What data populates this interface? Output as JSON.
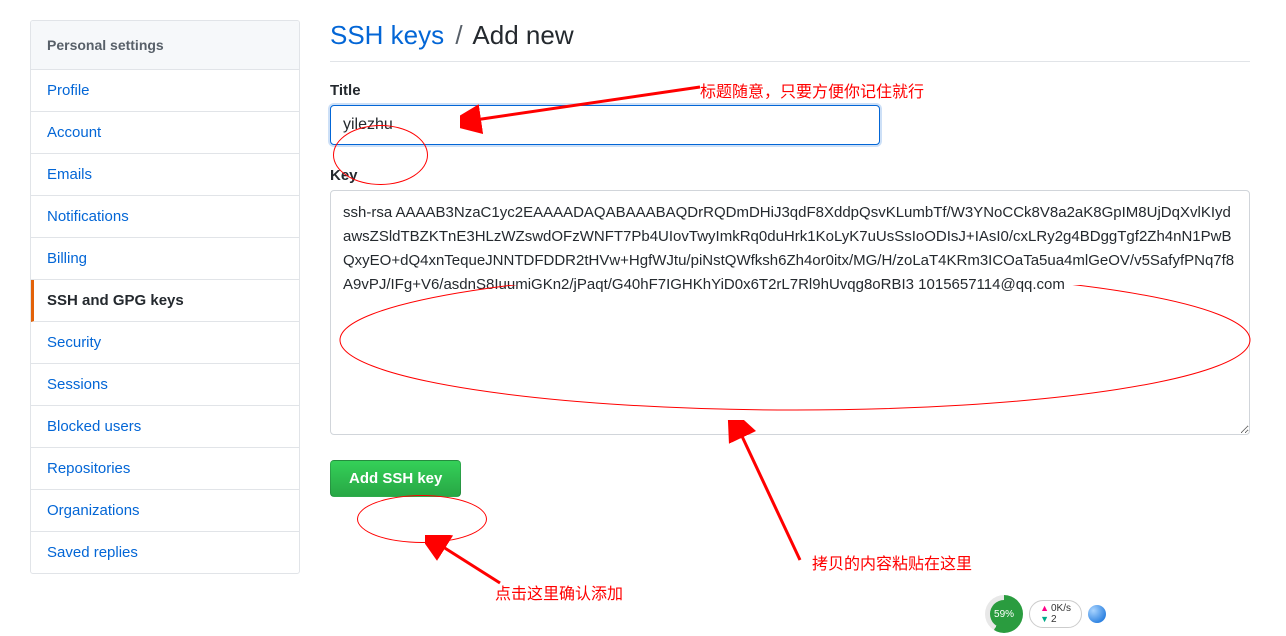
{
  "sidebar": {
    "header": "Personal settings",
    "items": [
      {
        "label": "Profile"
      },
      {
        "label": "Account"
      },
      {
        "label": "Emails"
      },
      {
        "label": "Notifications"
      },
      {
        "label": "Billing"
      },
      {
        "label": "SSH and GPG keys"
      },
      {
        "label": "Security"
      },
      {
        "label": "Sessions"
      },
      {
        "label": "Blocked users"
      },
      {
        "label": "Repositories"
      },
      {
        "label": "Organizations"
      },
      {
        "label": "Saved replies"
      }
    ],
    "active_index": 5
  },
  "heading": {
    "crumb": "SSH keys",
    "sep": "/",
    "leaf": "Add new"
  },
  "form": {
    "title_label": "Title",
    "title_value": "yilezhu",
    "key_label": "Key",
    "key_value": "ssh-rsa AAAAB3NzaC1yc2EAAAADAQABAAABAQDrRQDmDHiJ3qdF8XddpQsvKLumbTf/W3YNoCCk8V8a2aK8GpIM8UjDqXvlKIydawsZSldTBZKTnE3HLzWZswdOFzWNFT7Pb4UIovTwyImkRq0duHrk1KoLyK7uUsSsIoODIsJ+IAsI0/cxLRy2g4BDggTgf2Zh4nN1PwBQxyEO+dQ4xnTequeJNNTDFDDR2tHVw+HgfWJtu/piNstQWfksh6Zh4or0itx/MG/H/zoLaT4KRm3ICOaTa5ua4mlGeOV/v5SafyfPNq7f8A9vPJ/IFg+V6/asdnS8IuumiGKn2/jPaqt/G40hF7IGHKhYiD0x6T2rL7Rl9hUvqg8oRBI3 1015657114@qq.com",
    "submit_label": "Add SSH key"
  },
  "annotations": {
    "title_note": "标题随意，只要方便你记住就行",
    "key_note": "拷贝的内容粘贴在这里",
    "submit_note": "点击这里确认添加"
  },
  "widget": {
    "gauge": "59%",
    "up": "0K/s",
    "down": "2"
  }
}
